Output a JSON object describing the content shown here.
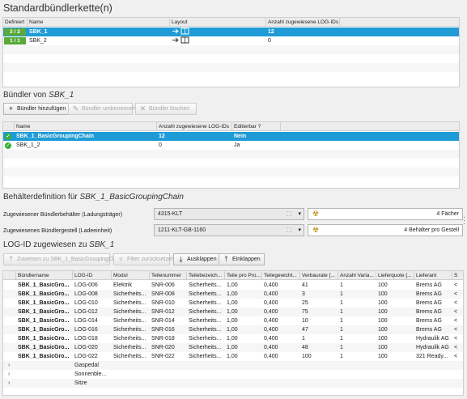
{
  "colors": {
    "selection": "#1f9bd6",
    "badge_green": "#5aa93a",
    "check_green": "#38b036",
    "nein_red": "#e2574c"
  },
  "chain": {
    "title": "Standardbündlerkette(n)",
    "columns": [
      "Definiert",
      "Name",
      "Layout",
      "Anzahl zugewiesene LOG-IDs"
    ],
    "rows": [
      {
        "defined": "2 / 2",
        "name": "SBK_1",
        "layout_icon": "arrow-box-icon",
        "count": "12"
      },
      {
        "defined": "1 / 1",
        "name": "SBK_2",
        "layout_icon": "arrow-box-icon",
        "count": "0"
      }
    ]
  },
  "bundler": {
    "title_prefix": "Bündler von",
    "title_ref": "SBK_1",
    "buttons": {
      "add": "Bündler hinzufügen",
      "rename": "Bündler umbenennen",
      "delete": "Bündler löschen"
    },
    "columns": [
      "",
      "Name",
      "Anzahl zugewiesene LOG-IDs",
      "Editierbar ?"
    ],
    "rows": [
      {
        "name": "SBK_1_BasicGroupingChain",
        "count": "12",
        "editable": "Nein"
      },
      {
        "name": "SBK_1_2",
        "count": "0",
        "editable": "Ja"
      }
    ]
  },
  "container": {
    "title_prefix": "Behälterdefinition für",
    "title_ref": "SBK_1_BasicGroupingChain",
    "carrier_label": "Zugewiesener Bündlerbehälter (Ladungsträger)",
    "carrier_value": "4315-KLT",
    "carrier_qty": "4 Fächer",
    "rack_label": "Zugewiesenes Bündlergestell (Ladeeinheit)",
    "rack_value": "1211-KLT-GB-1160",
    "rack_qty": "4 Behälter pro Gestell"
  },
  "logids": {
    "title_prefix": "LOG-ID zugewiesen zu",
    "title_ref": "SBK_1",
    "buttons": {
      "assign": "Zuweisen zu SBK_1_BasicGroupingChain",
      "reset": "Filter zurücksetzen",
      "expand": "Ausklappen",
      "collapse": "Einklappen"
    },
    "columns": [
      "Bündlername",
      "LOG-ID",
      "Modul",
      "Teilenummer",
      "Teilebezeich...",
      "Teile pro Pro...",
      "Teilegewicht...",
      "Verbaurate [...",
      "Anzahl Varia...",
      "Lieferquote [...",
      "Lieferant",
      "S"
    ],
    "rows": [
      {
        "bundler": "SBK_1_BasicGro...",
        "logid": "LOG-006",
        "module": "Elektrik",
        "part": "SNR-006",
        "desc": "Sicherheits...",
        "per": "1,00",
        "weight": "0,400",
        "rate": "41",
        "variants": "1",
        "quota": "100",
        "supplier": "Brems AG",
        "s": "<"
      },
      {
        "bundler": "SBK_1_BasicGro...",
        "logid": "LOG-008",
        "module": "Sicherheits...",
        "part": "SNR-008",
        "desc": "Sicherheits...",
        "per": "1,00",
        "weight": "0,400",
        "rate": "3",
        "variants": "1",
        "quota": "100",
        "supplier": "Brems AG",
        "s": "<"
      },
      {
        "bundler": "SBK_1_BasicGro...",
        "logid": "LOG-010",
        "module": "Sicherheits...",
        "part": "SNR-010",
        "desc": "Sicherheits...",
        "per": "1,00",
        "weight": "0,400",
        "rate": "25",
        "variants": "1",
        "quota": "100",
        "supplier": "Brems AG",
        "s": "<"
      },
      {
        "bundler": "SBK_1_BasicGro...",
        "logid": "LOG-012",
        "module": "Sicherheits...",
        "part": "SNR-012",
        "desc": "Sicherheits...",
        "per": "1,00",
        "weight": "0,400",
        "rate": "75",
        "variants": "1",
        "quota": "100",
        "supplier": "Brems AG",
        "s": "<"
      },
      {
        "bundler": "SBK_1_BasicGro...",
        "logid": "LOG-014",
        "module": "Sicherheits...",
        "part": "SNR-014",
        "desc": "Sicherheits...",
        "per": "1,00",
        "weight": "0,400",
        "rate": "10",
        "variants": "1",
        "quota": "100",
        "supplier": "Brems AG",
        "s": "<"
      },
      {
        "bundler": "SBK_1_BasicGro...",
        "logid": "LOG-016",
        "module": "Sicherheits...",
        "part": "SNR-016",
        "desc": "Sicherheits...",
        "per": "1,00",
        "weight": "0,400",
        "rate": "47",
        "variants": "1",
        "quota": "100",
        "supplier": "Brems AG",
        "s": "<"
      },
      {
        "bundler": "SBK_1_BasicGro...",
        "logid": "LOG-018",
        "module": "Sicherheits...",
        "part": "SNR-018",
        "desc": "Sicherheits...",
        "per": "1,00",
        "weight": "0,400",
        "rate": "1",
        "variants": "1",
        "quota": "100",
        "supplier": "Hydraulik AG",
        "s": "<"
      },
      {
        "bundler": "SBK_1_BasicGro...",
        "logid": "LOG-020",
        "module": "Sicherheits...",
        "part": "SNR-020",
        "desc": "Sicherheits...",
        "per": "1,00",
        "weight": "0,400",
        "rate": "48",
        "variants": "1",
        "quota": "100",
        "supplier": "Hydraulik AG",
        "s": "<"
      },
      {
        "bundler": "SBK_1_BasicGro...",
        "logid": "LOG-022",
        "module": "Sicherheits...",
        "part": "SNR-022",
        "desc": "Sicherheits...",
        "per": "1,00",
        "weight": "0,400",
        "rate": "100",
        "variants": "1",
        "quota": "100",
        "supplier": "321 Ready...",
        "s": "<"
      }
    ],
    "groups": [
      "Gaspedal",
      "Sonnenble...",
      "Sitze"
    ]
  }
}
